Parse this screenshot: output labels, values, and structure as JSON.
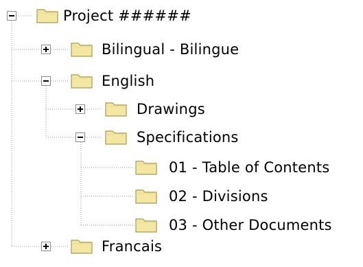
{
  "tree": {
    "root": {
      "label": "Project ######",
      "expanded": true,
      "children": [
        {
          "label": "Bilingual - Bilingue",
          "expanded": false
        },
        {
          "label": "English",
          "expanded": true,
          "children": [
            {
              "label": "Drawings",
              "expanded": false
            },
            {
              "label": "Specifications",
              "expanded": true,
              "children": [
                {
                  "label": "01 - Table of Contents"
                },
                {
                  "label": "02 - Divisions"
                },
                {
                  "label": "03 - Other Documents"
                }
              ]
            }
          ]
        },
        {
          "label": "Francais",
          "expanded": false
        }
      ]
    }
  },
  "colors": {
    "folder_fill": "#f4e7a2",
    "folder_stroke": "#a69a52",
    "connector": "#9a9a9a",
    "text": "#000000"
  },
  "icons": {
    "folder": "folder-icon",
    "expand": "plus-box-icon",
    "collapse": "minus-box-icon"
  }
}
